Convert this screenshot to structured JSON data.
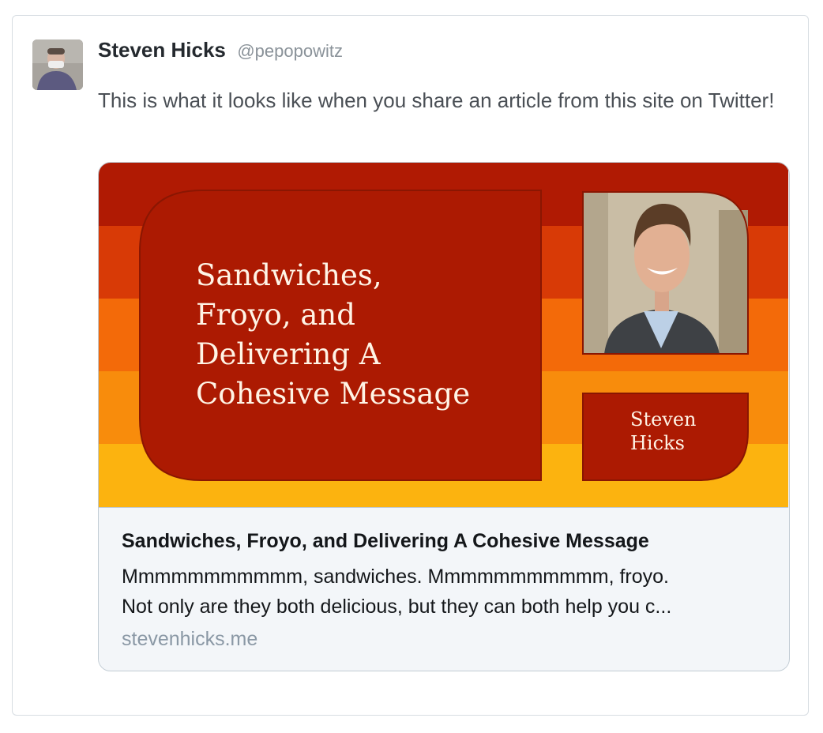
{
  "tweet": {
    "author": {
      "display_name": "Steven Hicks",
      "handle": "@pepopowitz"
    },
    "text": "This is what it looks like when you share an article from this site on Twitter!",
    "card": {
      "image": {
        "title_lines": [
          "Sandwiches,",
          "Froyo, and",
          "Delivering A",
          "Cohesive Message"
        ],
        "author_lines": [
          "Steven",
          "Hicks"
        ],
        "stripe_colors": [
          "#b01a03",
          "#d83a06",
          "#f36a09",
          "#f88c0c",
          "#fcb30f"
        ],
        "panel_color": "#ac1a02"
      },
      "title": "Sandwiches, Froyo, and Delivering A Cohesive Message",
      "description_lines": [
        "Mmmmmmmmmmm, sandwiches. Mmmmmmmmmmm, froyo.",
        "Not only are they both delicious, but they can both help you c..."
      ],
      "domain": "stevenhicks.me"
    }
  }
}
